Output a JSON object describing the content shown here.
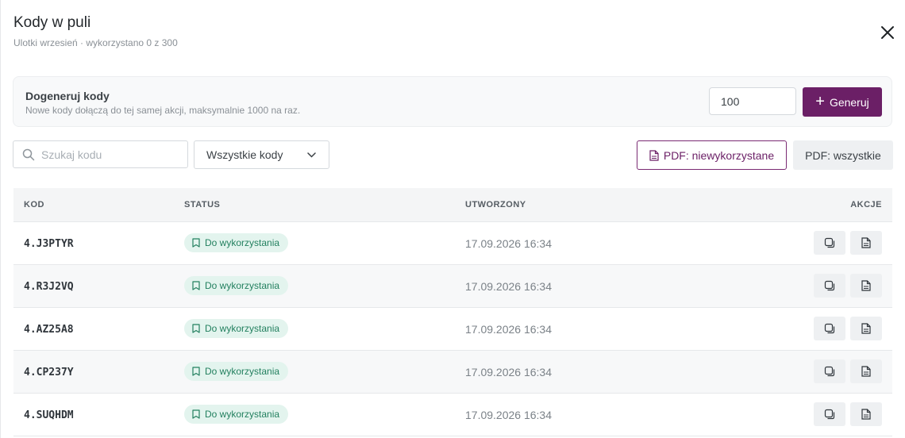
{
  "header": {
    "title": "Kody w puli",
    "subtitle": "Ulotki wrzesień · wykorzystano 0 z 300"
  },
  "generate": {
    "title": "Dogeneruj kody",
    "description": "Nowe kody dołączą do tej samej akcji, maksymalnie 1000 na raz.",
    "count": "100",
    "button_label": "Generuj",
    "accent": "#6b1f66"
  },
  "toolbar": {
    "search_placeholder": "Szukaj kodu",
    "filter_value": "Wszystkie kody",
    "pdf_unused_label": "PDF: niewykorzystane",
    "pdf_all_label": "PDF: wszystkie"
  },
  "table": {
    "columns": {
      "code": "KOD",
      "status": "STATUS",
      "created": "UTWORZONY",
      "actions": "AKCJE"
    },
    "rows": [
      {
        "code": "4.J3PTYR",
        "status": "Do wykorzystania",
        "created": "17.09.2026 16:34"
      },
      {
        "code": "4.R3J2VQ",
        "status": "Do wykorzystania",
        "created": "17.09.2026 16:34"
      },
      {
        "code": "4.AZ25A8",
        "status": "Do wykorzystania",
        "created": "17.09.2026 16:34"
      },
      {
        "code": "4.CP237Y",
        "status": "Do wykorzystania",
        "created": "17.09.2026 16:34"
      },
      {
        "code": "4.SUQHDM",
        "status": "Do wykorzystania",
        "created": "17.09.2026 16:34"
      }
    ],
    "status_color": "#23805f",
    "status_bg": "#e3f4ee",
    "icons": [
      "copy-icon",
      "pdf-file-icon",
      "ticket-icon"
    ]
  }
}
